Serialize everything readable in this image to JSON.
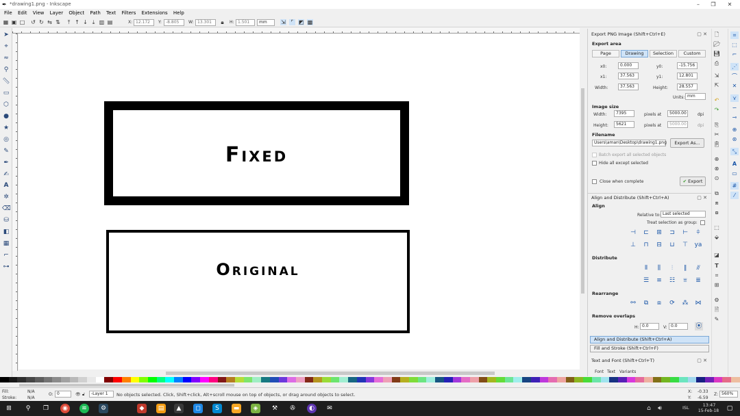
{
  "window": {
    "title": "*drawing1.png - Inkscape",
    "minimize": "–",
    "maximize": "❐",
    "close": "✕"
  },
  "menu": [
    "File",
    "Edit",
    "View",
    "Layer",
    "Object",
    "Path",
    "Text",
    "Filters",
    "Extensions",
    "Help"
  ],
  "toolbar": {
    "x_label": "X:",
    "x_value": "12.172",
    "y_label": "Y:",
    "y_value": "-8.805",
    "w_label": "W:",
    "w_value": "13.301",
    "h_label": "H:",
    "h_value": "1.501",
    "unit": "mm"
  },
  "canvas": {
    "text_fixed": "Fixed",
    "text_original": "Original"
  },
  "export_panel": {
    "title": "Export PNG Image (Shift+Ctrl+E)",
    "export_area": "Export area",
    "tabs": [
      "Page",
      "Drawing",
      "Selection",
      "Custom"
    ],
    "active_tab": "Drawing",
    "x0_label": "x0:",
    "x0": "0.000",
    "y0_label": "y0:",
    "y0": "-15.756",
    "x1_label": "x1:",
    "x1": "37.563",
    "y1_label": "y1:",
    "y1": "12.801",
    "width_label": "Width:",
    "width": "37.563",
    "height_label": "Height:",
    "height": "28.557",
    "units_label": "Units:",
    "units": "mm",
    "image_size": "Image size",
    "img_width_label": "Width:",
    "img_width": "7395",
    "img_height_label": "Height:",
    "img_height": "5621",
    "pixels_at": "pixels at",
    "dpi_value": "5000.00",
    "dpi_value2": "5000.00",
    "dpi": "dpi",
    "filename_label": "Filename",
    "filename": "Users\\aman\\Desktop\\drawing1.png",
    "export_as": "Export As...",
    "batch_export": "Batch export all selected objects",
    "hide_all": "Hide all except selected",
    "close_when_complete": "Close when complete",
    "export_button": "Export"
  },
  "align_panel": {
    "title": "Align and Distribute (Shift+Ctrl+A)",
    "align": "Align",
    "relative_to_label": "Relative to:",
    "relative_to": "Last selected",
    "treat_selection": "Treat selection as group:",
    "distribute": "Distribute",
    "rearrange": "Rearrange",
    "remove_overlaps": "Remove overlaps",
    "h_gap_label": "H:",
    "h_gap": "0.0",
    "v_gap_label": "V:",
    "v_gap": "0.0"
  },
  "collapsed_panels": [
    "Align and Distribute (Shift+Ctrl+A)",
    "Fill and Stroke (Shift+Ctrl+F)"
  ],
  "text_font_panel": {
    "title": "Text and Font (Shift+Ctrl+T)",
    "tabs": [
      "Font",
      "Text",
      "Variants"
    ]
  },
  "status": {
    "fill_label": "Fill:",
    "fill_value": "N/A",
    "stroke_label": "Stroke:",
    "stroke_value": "N/A",
    "opacity_label": "O:",
    "opacity_value": "0",
    "layer": "-Layer 1",
    "message": "No objects selected. Click, Shift+click, Alt+scroll mouse on top of objects, or drag around objects to select.",
    "x_label": "X:",
    "x_coord": "-0.33",
    "y_label": "Y:",
    "y_coord": "-6.59",
    "zoom_label": "Z:",
    "zoom": "560%"
  },
  "taskbar": {
    "time": "13:47",
    "date": "15-Feb-18",
    "lang": "ISL"
  },
  "colors": {
    "accent": "#cfe3f7",
    "canvas_bg": "#ffffff",
    "taskbar_bg": "#1e1e1e"
  }
}
